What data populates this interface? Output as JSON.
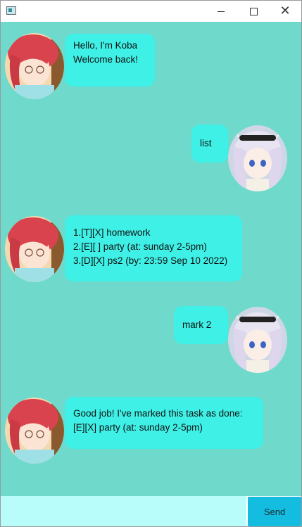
{
  "window": {
    "controls": {
      "minimize": "minimize",
      "maximize": "maximize",
      "close": "close"
    }
  },
  "colors": {
    "chat_background": "#6fd9cc",
    "bubble": "#3ff0e6",
    "input_background": "#b8fdfa",
    "send_button": "#14bde0"
  },
  "messages": [
    {
      "sender": "bot",
      "text": "Hello, I'm Koba\nWelcome back!"
    },
    {
      "sender": "user",
      "text": "list"
    },
    {
      "sender": "bot",
      "text": "1.[T][X] homework\n2.[E][ ] party (at: sunday 2-5pm)\n3.[D][X] ps2 (by: 23:59 Sep 10 2022)"
    },
    {
      "sender": "user",
      "text": "mark 2"
    },
    {
      "sender": "bot",
      "text": "Good job! I've marked this task as done:\n[E][X] party (at: sunday 2-5pm)"
    }
  ],
  "input": {
    "value": "",
    "placeholder": ""
  },
  "send_button": {
    "label": "Send"
  }
}
